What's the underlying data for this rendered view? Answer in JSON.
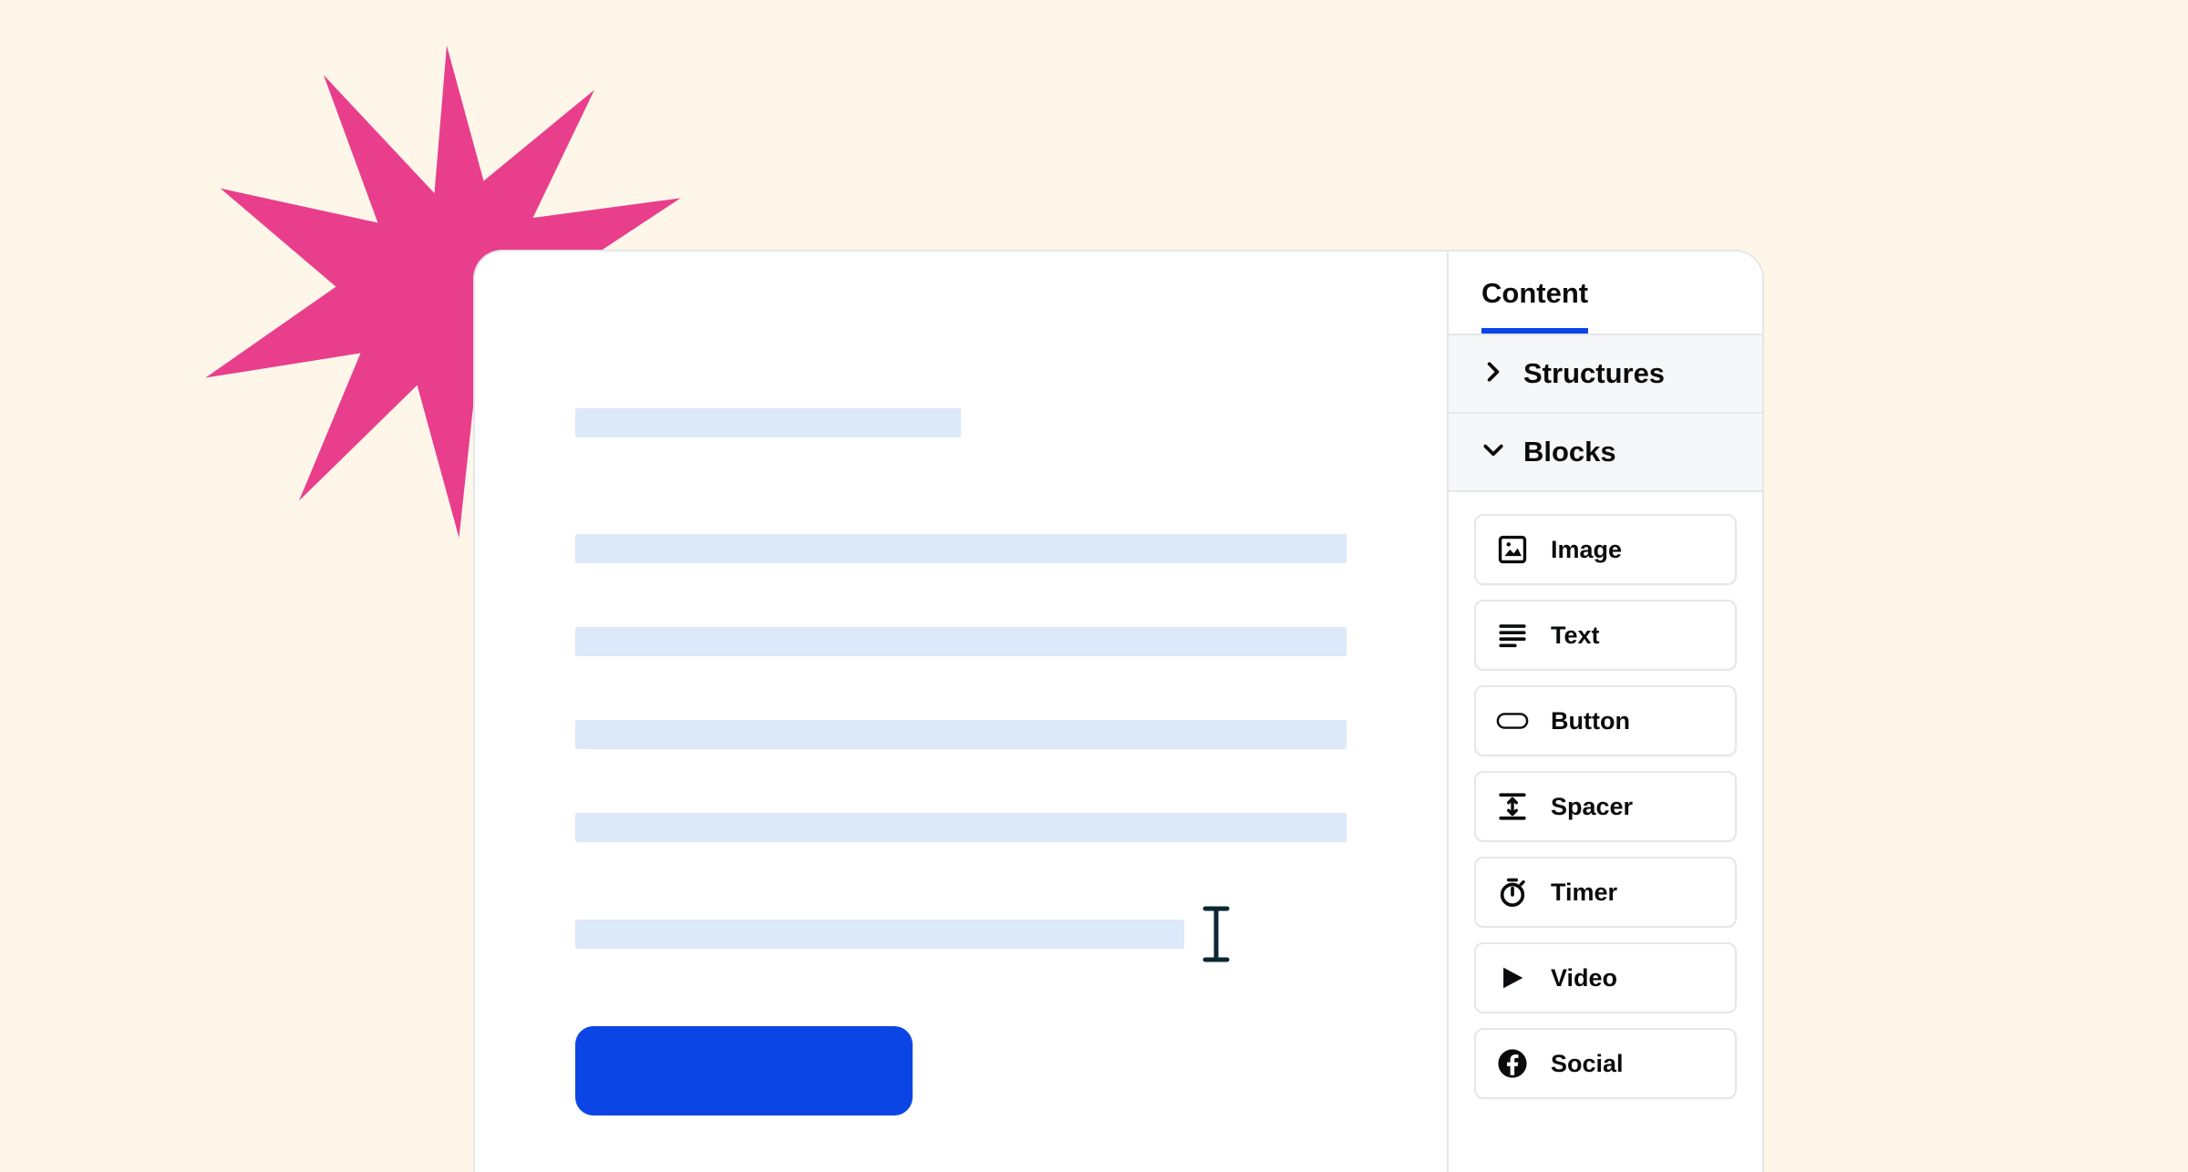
{
  "colors": {
    "accent_blue": "#0c45e6",
    "pink_star": "#e83e8c",
    "placeholder": "#dbe9f9",
    "background": "#fdf6e9",
    "ink": "#0a0b0d"
  },
  "sidebar": {
    "tab_label": "Content",
    "sections": {
      "structures": {
        "label": "Structures",
        "expanded": false
      },
      "blocks": {
        "label": "Blocks",
        "expanded": true
      }
    },
    "block_items": [
      {
        "icon": "image-icon",
        "label": "Image"
      },
      {
        "icon": "text-icon",
        "label": "Text"
      },
      {
        "icon": "button-icon",
        "label": "Button"
      },
      {
        "icon": "spacer-icon",
        "label": "Spacer"
      },
      {
        "icon": "timer-icon",
        "label": "Timer"
      },
      {
        "icon": "video-icon",
        "label": "Video"
      },
      {
        "icon": "social-icon",
        "label": "Social"
      }
    ]
  },
  "canvas": {
    "button_label": ""
  }
}
